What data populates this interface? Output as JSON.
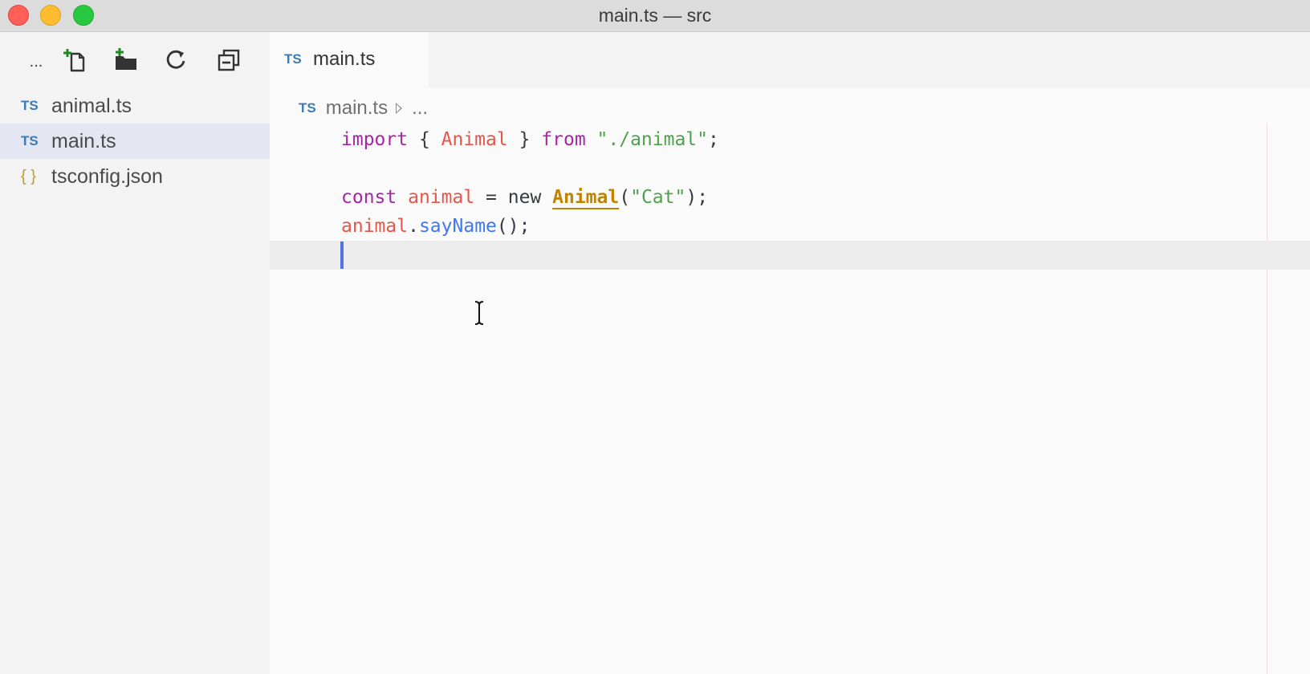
{
  "window": {
    "title": "main.ts — src"
  },
  "sidebar": {
    "toolbar": {
      "more_label": "..."
    },
    "files": [
      {
        "icon": "TS",
        "name": "animal.ts"
      },
      {
        "icon": "TS",
        "name": "main.ts"
      },
      {
        "icon": "{ }",
        "name": "tsconfig.json"
      }
    ]
  },
  "editor": {
    "tab": {
      "icon": "TS",
      "label": "main.ts"
    },
    "breadcrumb": {
      "icon": "TS",
      "file": "main.ts",
      "more": "..."
    },
    "code": {
      "line1": {
        "t1": "import",
        "t2": " { ",
        "t3": "Animal",
        "t4": " } ",
        "t5": "from",
        "t6": " ",
        "t7": "\"./animal\"",
        "t8": ";"
      },
      "line3": {
        "t1": "const",
        "t2": " ",
        "t3": "animal",
        "t4": " = new ",
        "t5": "Animal",
        "t6": "(",
        "t7": "\"Cat\"",
        "t8": ");"
      },
      "line4": {
        "t1": "animal",
        "t2": ".",
        "t3": "sayName",
        "t4": "();"
      }
    }
  },
  "colors": {
    "keyword": "#a626a4",
    "variable": "#e45649",
    "string": "#50a14f",
    "class": "#c18401",
    "function": "#4078f2",
    "cursor": "#5271e8"
  }
}
